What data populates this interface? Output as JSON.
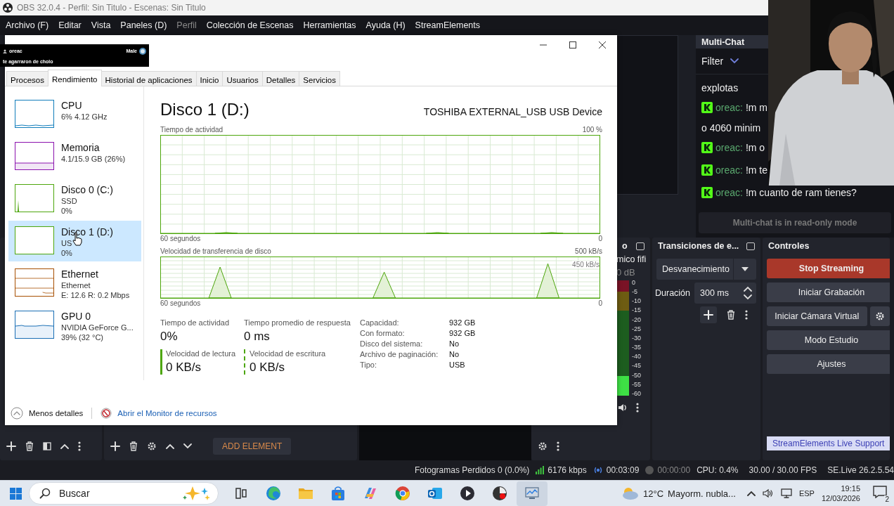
{
  "obs": {
    "title": "OBS 32.0.4 - Perfil: Sin Titulo - Escenas: Sin Titulo",
    "menu": [
      {
        "label": "Archivo (F)",
        "disabled": false
      },
      {
        "label": "Editar",
        "disabled": false
      },
      {
        "label": "Vista",
        "disabled": false
      },
      {
        "label": "Paneles (D)",
        "disabled": false
      },
      {
        "label": "Perfil",
        "disabled": true
      },
      {
        "label": "Colección de Escenas",
        "disabled": false
      },
      {
        "label": "Herramientas",
        "disabled": false
      },
      {
        "label": "Ayuda (H)",
        "disabled": false
      },
      {
        "label": "StreamElements",
        "disabled": false
      }
    ]
  },
  "chat": {
    "title": "Multi-Chat",
    "filter": "Filter",
    "footer": "Multi-chat is in read-only mode",
    "messages": [
      {
        "kind": "continuation",
        "text": "explotas"
      },
      {
        "kind": "message",
        "user": "oreac:",
        "text": "!m m"
      },
      {
        "kind": "continuation",
        "text": "o 4060 minim"
      },
      {
        "kind": "message",
        "user": "oreac:",
        "text": "!m o"
      },
      {
        "kind": "message",
        "user": "oreac:",
        "text": "!m te"
      },
      {
        "kind": "message",
        "user": "oreac:",
        "text": "!m cuanto de ram tienes?"
      }
    ]
  },
  "sources": {
    "add_element": "ADD ELEMENT"
  },
  "mixer": {
    "title": "o",
    "source": "mico fifi",
    "reading": "0 dB",
    "level": 0.17,
    "scale": [
      "0",
      "-5",
      "-10",
      "-15",
      "-20",
      "-25",
      "-30",
      "-35",
      "-40",
      "-45",
      "-50",
      "-55",
      "-60"
    ]
  },
  "transitions": {
    "title": "Transiciones de e...",
    "transition": "Desvanecimiento",
    "duration_label": "Duración",
    "duration": "300 ms"
  },
  "controls": {
    "title": "Controles",
    "buttons": [
      {
        "label": "Stop Streaming",
        "kind": "stop"
      },
      {
        "label": "Iniciar Grabación",
        "kind": "normal"
      },
      {
        "label": "Iniciar Cámara Virtual",
        "kind": "with_settings"
      },
      {
        "label": "Modo Estudio",
        "kind": "normal"
      },
      {
        "label": "Ajustes",
        "kind": "normal"
      }
    ],
    "support": "StreamElements Live Support"
  },
  "status": {
    "dropped": "Fotogramas Perdidos 0 (0.0%)",
    "bitrate": "6176 kbps",
    "stream_time": "00:03:09",
    "record_time": "00:00:00",
    "cpu": "CPU: 0.4%",
    "fps": "30.00 / 30.00 FPS",
    "version": "SE.Live 26.2.5.54"
  },
  "notification": {
    "user": "oreac",
    "badge": "Male",
    "message": "te agarraron de cholo"
  },
  "task_manager": {
    "tabs": [
      {
        "label": "Procesos",
        "selected": false
      },
      {
        "label": "Rendimiento",
        "selected": true
      },
      {
        "label": "Historial de aplicaciones",
        "selected": false
      },
      {
        "label": "Inicio",
        "selected": false
      },
      {
        "label": "Usuarios",
        "selected": false
      },
      {
        "label": "Detalles",
        "selected": false
      },
      {
        "label": "Servicios",
        "selected": false
      }
    ],
    "sidebar": {
      "items": [
        {
          "kind": "cpu",
          "name": "CPU",
          "lines": [
            "6% 4.12 GHz"
          ],
          "color": "#117dbb",
          "selected": false
        },
        {
          "kind": "memory",
          "name": "Memoria",
          "lines": [
            "4.1/15.9 GB (26%)"
          ],
          "color": "#8b12ae",
          "selected": false
        },
        {
          "kind": "disk_spike",
          "name": "Disco 0 (C:)",
          "lines": [
            "SSD",
            "0%"
          ],
          "color": "#4da60c",
          "selected": false
        },
        {
          "kind": "disk",
          "name": "Disco 1 (D:)",
          "lines": [
            "US",
            "0%"
          ],
          "color": "#4da60c",
          "selected": true
        },
        {
          "kind": "network",
          "name": "Ethernet",
          "lines": [
            "Ethernet",
            "E: 12.6 R: 0.2 Mbps"
          ],
          "color": "#a74f01",
          "selected": false
        },
        {
          "kind": "gpu",
          "name": "GPU 0",
          "lines": [
            "NVIDIA GeForce G...",
            "39% (32 °C)"
          ],
          "color": "#1a6fb5",
          "selected": false
        }
      ]
    },
    "detail": {
      "title": "Disco 1 (D:)",
      "device": "TOSHIBA EXTERNAL_USB USB Device",
      "graphs": [
        {
          "kind": "activity",
          "title": "Tiempo de actividad",
          "max_label": "100 %",
          "span_label": "60 segundos",
          "min_label": "0"
        },
        {
          "kind": "transfer",
          "title": "Velocidad de transferencia de disco",
          "max_label": "500 kB/s",
          "span_label": "60 segundos",
          "min_label": "0",
          "scale_note": "450 kB/s"
        }
      ],
      "stats": [
        {
          "kind": "plain",
          "label": "Tiempo de actividad",
          "value": "0%"
        },
        {
          "kind": "plain",
          "label": "Tiempo promedio de respuesta",
          "value": "0 ms"
        },
        {
          "kind": "solid",
          "label": "Velocidad de lectura",
          "value": "0 KB/s"
        },
        {
          "kind": "dashed",
          "label": "Velocidad de escritura",
          "value": "0 KB/s"
        }
      ],
      "properties": [
        {
          "label": "Capacidad:",
          "value": "932 GB"
        },
        {
          "label": "Con formato:",
          "value": "932 GB"
        },
        {
          "label": "Disco del sistema:",
          "value": "No"
        },
        {
          "label": "Archivo de paginación:",
          "value": "No"
        },
        {
          "label": "Tipo:",
          "value": "USB"
        }
      ]
    },
    "footer": {
      "less_details": "Menos detalles",
      "link": "Abrir el Monitor de recursos"
    }
  },
  "taskbar": {
    "search_placeholder": "Buscar",
    "apps": [
      {
        "kind": "taskview",
        "active": false
      },
      {
        "kind": "browser",
        "active": false
      },
      {
        "kind": "folder",
        "active": false
      },
      {
        "kind": "store",
        "active": false
      },
      {
        "kind": "ribbon",
        "active": false
      },
      {
        "kind": "round_browser",
        "active": false
      },
      {
        "kind": "mail",
        "active": false
      },
      {
        "kind": "player",
        "active": false
      },
      {
        "kind": "recorder",
        "active": false
      },
      {
        "kind": "monitor",
        "active": true
      }
    ],
    "weather": {
      "temperature": "12°C",
      "condition": "Mayorm. nubla..."
    },
    "language": "ESP",
    "time": "19:15",
    "date": "12/03/2026",
    "notifications": "2"
  }
}
